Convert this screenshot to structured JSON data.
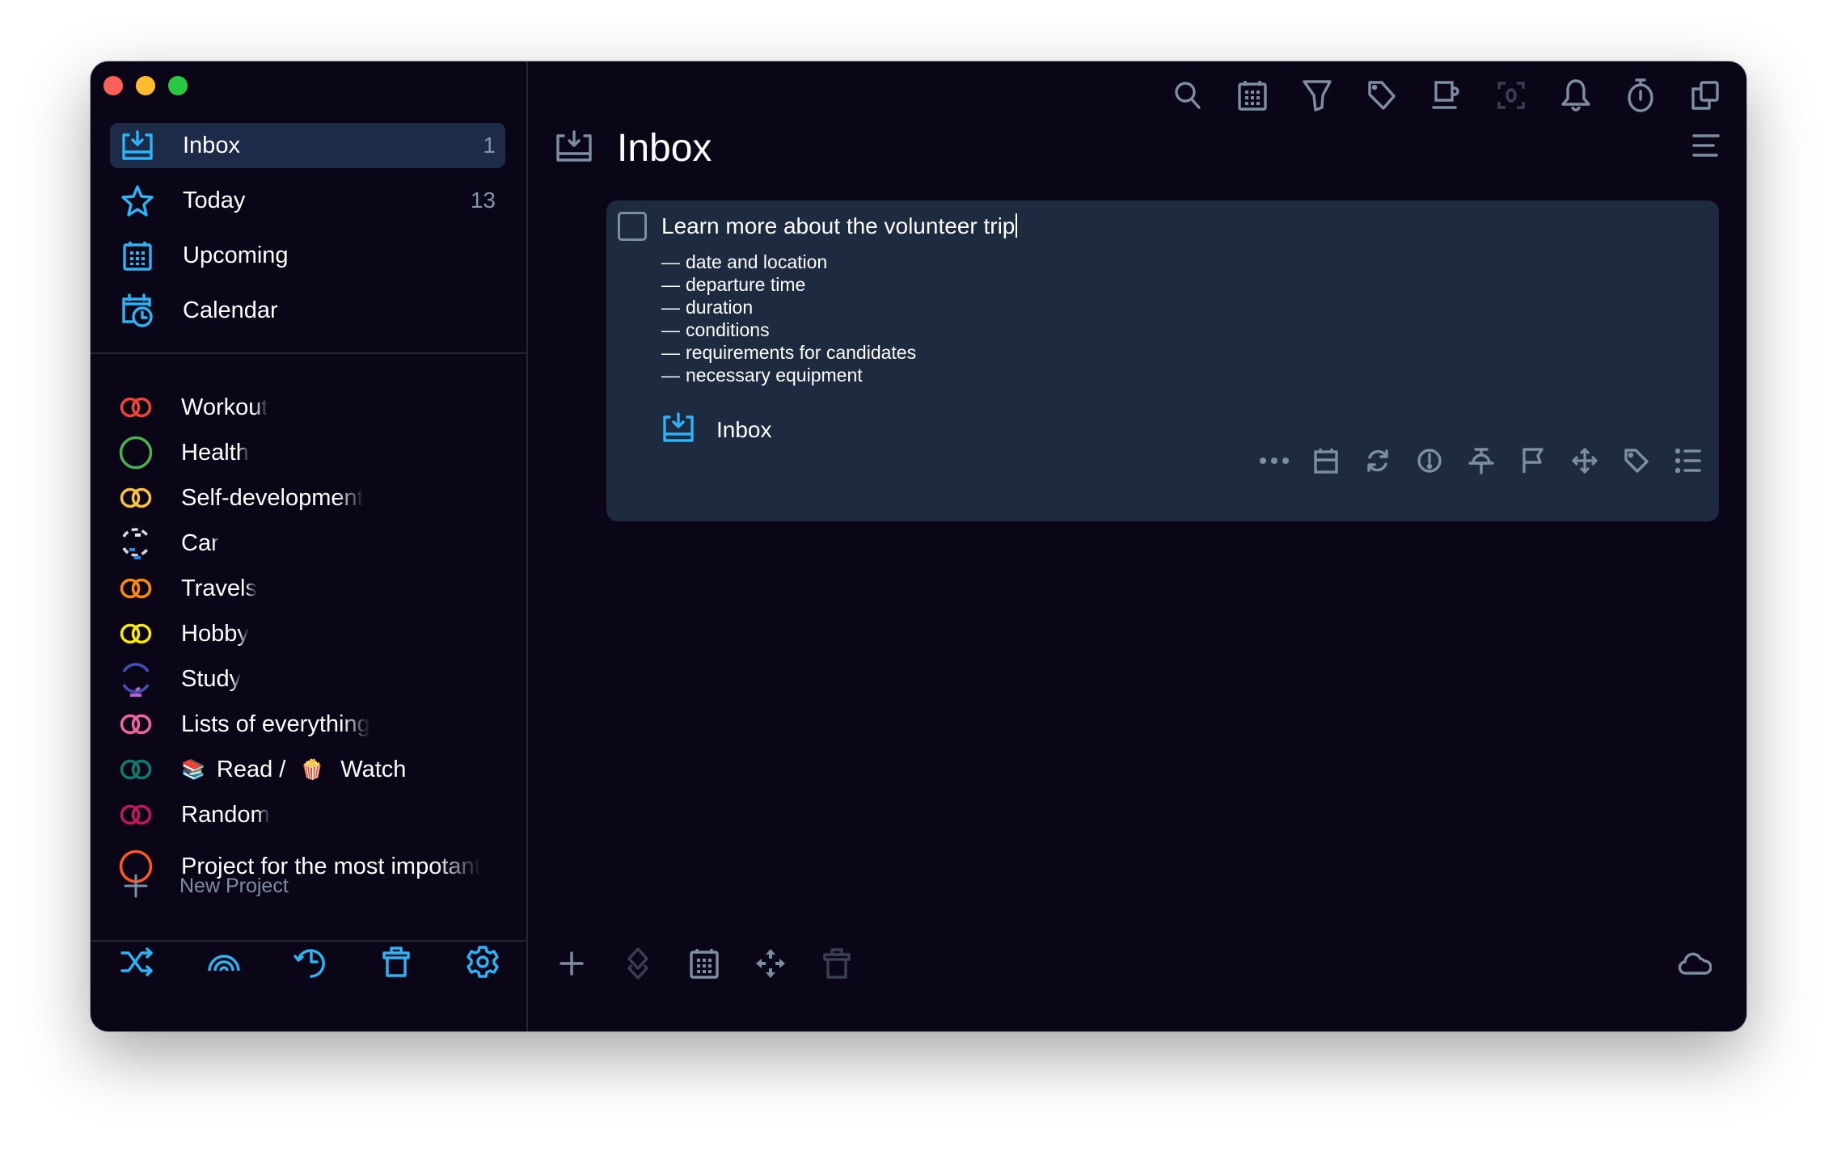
{
  "window": {
    "controls": [
      "close",
      "minimize",
      "zoom"
    ]
  },
  "colors": {
    "accent": "#2bb4f6",
    "background": "#0b0617",
    "selected": "#1e2b48",
    "card": "#1e2a40",
    "muted_icon": "#7d8ea3"
  },
  "sidebar": {
    "nav": [
      {
        "label": "Inbox",
        "count": "1",
        "icon": "inbox-icon",
        "active": true
      },
      {
        "label": "Today",
        "count": "13",
        "icon": "star-icon"
      },
      {
        "label": "Upcoming",
        "count": "",
        "icon": "calendar-grid-icon"
      },
      {
        "label": "Calendar",
        "count": "",
        "icon": "calendar-clock-icon"
      }
    ],
    "projects": [
      {
        "label": "Workout",
        "color": "#f0433a",
        "icon": "double-ring"
      },
      {
        "label": "Health",
        "color": "#4caf50",
        "icon": "ring"
      },
      {
        "label": "Self-development",
        "color": "#f9c13e",
        "icon": "double-ring"
      },
      {
        "label": "Car",
        "color": "#d8d8de",
        "icon": "progress-ring"
      },
      {
        "label": "Travels",
        "color": "#ff8a00",
        "icon": "double-ring"
      },
      {
        "label": "Hobby",
        "color": "#f7ea00",
        "icon": "double-ring"
      },
      {
        "label": "Study",
        "color": "#3f51b5",
        "icon": "progress-ring"
      },
      {
        "label": "Lists of everything",
        "color": "#f0649a",
        "icon": "double-ring"
      },
      {
        "label_part1": "Read / ",
        "emoji1": "📚",
        "emoji2": "🍿",
        "label_part2": "Watch",
        "color": "#0e7a6b",
        "icon": "double-ring"
      },
      {
        "label": "Random",
        "color": "#c2185b",
        "icon": "double-ring"
      },
      {
        "label": "Project for the most impotant",
        "color": "#ff5722",
        "icon": "ring"
      }
    ],
    "new_project": "New Project",
    "bottom_actions": [
      "shuffle-icon",
      "rainbow-icon",
      "history-icon",
      "trash-icon",
      "settings-icon"
    ]
  },
  "main": {
    "toolbar": [
      "search-icon",
      "calendar-icon",
      "filter-icon",
      "tag-icon",
      "coffee-icon",
      "focus-icon",
      "bell-icon",
      "stopwatch-icon",
      "copy-icon"
    ],
    "title": "Inbox",
    "task": {
      "title": "Learn more about the volunteer trip",
      "completed": false,
      "notes": [
        "date and location",
        "departure time",
        "duration",
        "conditions",
        "requirements for candidates",
        "necessary equipment"
      ],
      "note_prefix": "—",
      "project": "Inbox",
      "actions": [
        "more-icon",
        "date-icon",
        "repeat-icon",
        "priority-icon",
        "pin-icon",
        "flag-icon",
        "move-icon",
        "tag-icon",
        "checklist-icon"
      ]
    },
    "bottom_toolbar": [
      "add-icon",
      "layers-icon",
      "calendar-icon",
      "move-icon",
      "trash-icon"
    ],
    "sync_icon": "cloud-icon"
  }
}
